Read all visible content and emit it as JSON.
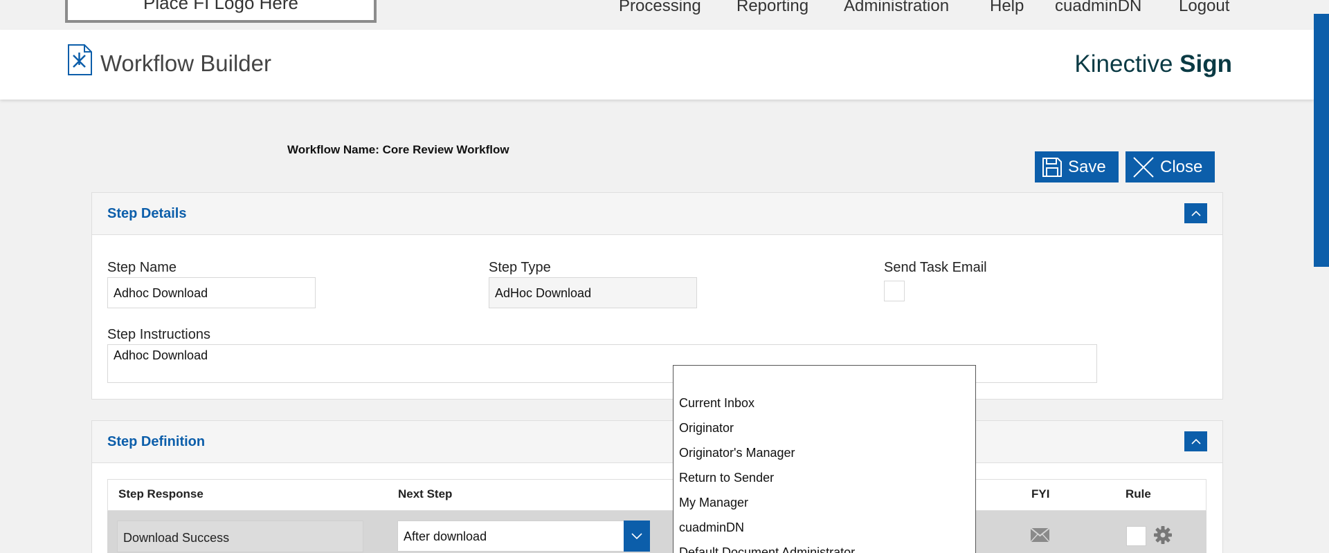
{
  "topnav": {
    "logo_text": "Place FI Logo Here",
    "items": [
      "Processing",
      "Reporting",
      "Administration",
      "Help",
      "cuadminDN",
      "Logout"
    ]
  },
  "header": {
    "title": "Workflow Builder",
    "brand_light": "Kinective",
    "brand_bold": "Sign"
  },
  "workflow": {
    "name_label": "Workflow Name:",
    "name_value": "Core Review Workflow"
  },
  "toolbar": {
    "save_label": "Save",
    "close_label": "Close"
  },
  "step_details": {
    "title": "Step Details",
    "step_name_label": "Step Name",
    "step_name_value": "Adhoc Download",
    "step_type_label": "Step Type",
    "step_type_value": "AdHoc Download",
    "send_task_email_label": "Send Task Email",
    "step_instructions_label": "Step Instructions",
    "step_instructions_value": "Adhoc Download"
  },
  "step_definition": {
    "title": "Step Definition",
    "columns": [
      "Step Response",
      "Next Step",
      "FYI",
      "Rule"
    ],
    "rows": [
      {
        "response": "Download Success",
        "next_step": "After download"
      }
    ]
  },
  "dropdown": {
    "options": [
      "",
      "Current Inbox",
      "Originator",
      "Originator's Manager",
      "Return to Sender",
      "My Manager",
      "cuadminDN",
      "Default Document Administrator"
    ]
  },
  "colors": {
    "accent": "#0c5eaa",
    "brand_text": "#0a3a44"
  }
}
